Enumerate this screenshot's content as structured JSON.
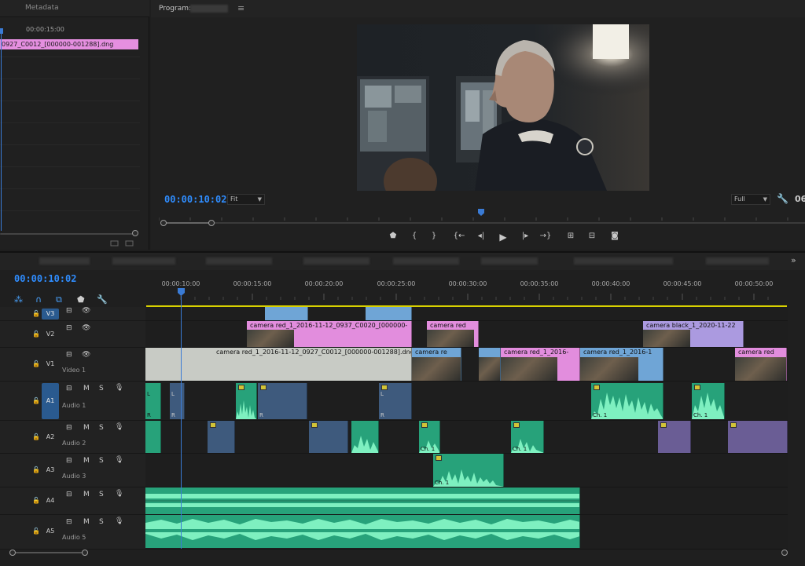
{
  "source_panel": {
    "tab": "Metadata",
    "timecode": "00:00:15:00",
    "clip": "0927_C0012_[000000-001288].dng"
  },
  "program_monitor": {
    "title": "Program:",
    "menu_icon": "≡",
    "timecode": "00:00:10:02",
    "fit": "Fit",
    "quality": "Full",
    "extra": "06",
    "transport": [
      "marker-icon",
      "mark-in-icon",
      "mark-out-icon",
      "go-to-in-icon",
      "step-back-icon",
      "play-icon",
      "step-forward-icon",
      "go-to-out-icon",
      "lift-icon",
      "extract-icon",
      "export-frame-icon"
    ]
  },
  "timeline": {
    "timecode": "00:00:10:02",
    "more": "»",
    "ruler": [
      "00:00:10:00",
      "00:00:15:00",
      "00:00:20:00",
      "00:00:25:00",
      "00:00:30:00",
      "00:00:35:00",
      "00:00:40:00",
      "00:00:45:00",
      "00:00:50:00"
    ],
    "tracks": {
      "v3": {
        "label": "V3",
        "name": ""
      },
      "v2": {
        "label": "V2",
        "name": ""
      },
      "v1": {
        "label": "V1",
        "name": "Video 1"
      },
      "a1": {
        "label": "A1",
        "name": "Audio 1"
      },
      "a2": {
        "label": "A2",
        "name": "Audio 2"
      },
      "a3": {
        "label": "A3",
        "name": "Audio 3"
      },
      "a4": {
        "label": "A4",
        "name": ""
      },
      "a5": {
        "label": "A5",
        "name": "Audio 5"
      }
    },
    "track_buttons": {
      "mute": "M",
      "solo": "S"
    },
    "clips": {
      "v2_a": "camera red_1_2016-11-12_0937_C0020_[000000-",
      "v2_b": "camera red",
      "v2_c": "camera black_1_2020-11-22",
      "v1_main": "camera red_1_2016-11-12_0927_C0012_[000000-001288].dng",
      "v1_b": "camera re",
      "v1_c": "camera red_1_2016-",
      "v1_d": "camera red_1_2016-1",
      "v1_e": "camera red"
    },
    "audio_labels": {
      "left": "L",
      "right": "R",
      "ch": "Ch. 1"
    }
  },
  "colors": {
    "accent": "#2f8dff",
    "playhead": "#3a7bd5",
    "work_area": "#d8d000"
  }
}
